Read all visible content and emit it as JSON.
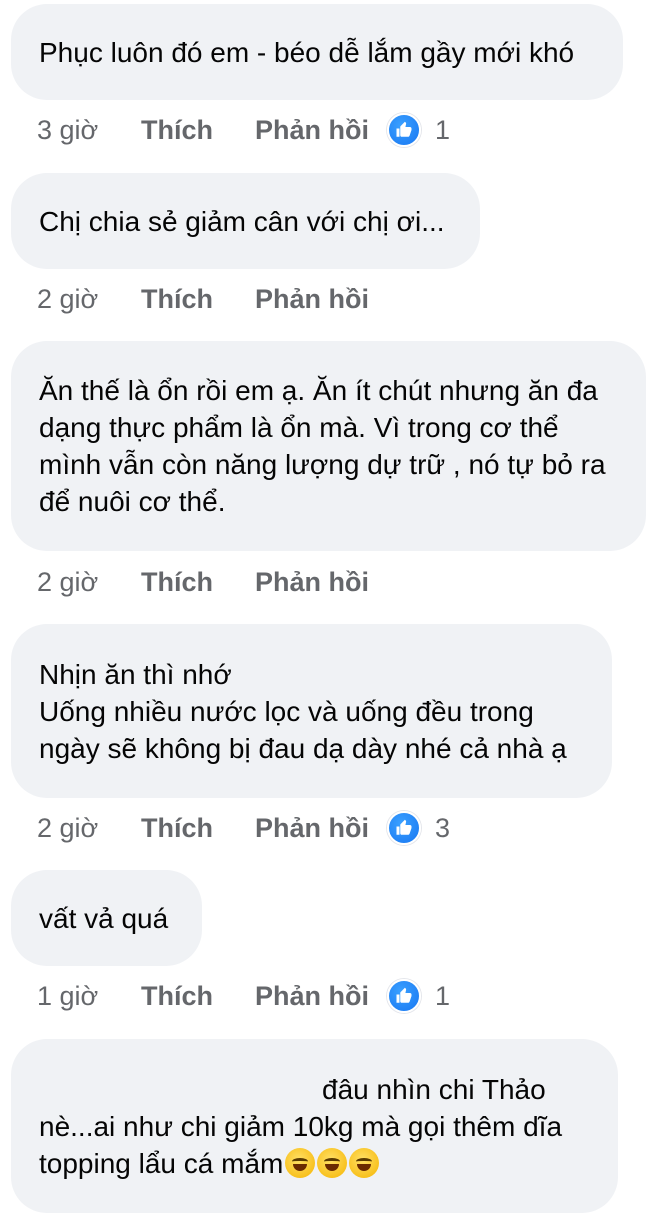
{
  "comments": [
    {
      "text": "Phục luôn  đó em - béo dễ lắm gầy mới khó",
      "time": "3 giờ",
      "like_label": "Thích",
      "reply_label": "Phản hồi",
      "reaction_icon": "like-icon",
      "reaction_count": "1"
    },
    {
      "text": "Chị chia sẻ giảm cân với chị ơi...",
      "time": "2 giờ",
      "like_label": "Thích",
      "reply_label": "Phản hồi"
    },
    {
      "text": "Ăn thế là ổn rồi em ạ. Ăn ít chút nhưng ăn đa\ndạng thực phẩm là ổn mà. Vì trong cơ thể\nmình vẫn còn năng lượng dự trữ , nó tự bỏ ra\nđể nuôi cơ thể.",
      "time": "2 giờ",
      "like_label": "Thích",
      "reply_label": "Phản hồi"
    },
    {
      "text": "Nhịn ăn thì nhớ\nUống nhiều nước lọc và uống đều trong\nngày sẽ không bị đau dạ dày nhé cả nhà ạ",
      "time": "2 giờ",
      "like_label": "Thích",
      "reply_label": "Phản hồi",
      "reaction_icon": "like-icon",
      "reaction_count": "3"
    },
    {
      "text": "vất vả quá",
      "time": "1 giờ",
      "like_label": "Thích",
      "reply_label": "Phản hồi",
      "reaction_icon": "like-icon",
      "reaction_count": "1"
    },
    {
      "text_line1": "đâu nhìn chi Thảo",
      "text_line2": "nè...ai như chi giảm 10kg mà gọi thêm dĩa",
      "text_line3": "topping lẩu cá mắm",
      "emoji": [
        "rolling-on-floor-laughing-emoji",
        "rolling-on-floor-laughing-emoji",
        "rolling-on-floor-laughing-emoji"
      ]
    }
  ],
  "colors": {
    "bubble_bg": "#f0f2f5",
    "meta_text": "#65676b",
    "like_blue": "#1877f2"
  }
}
